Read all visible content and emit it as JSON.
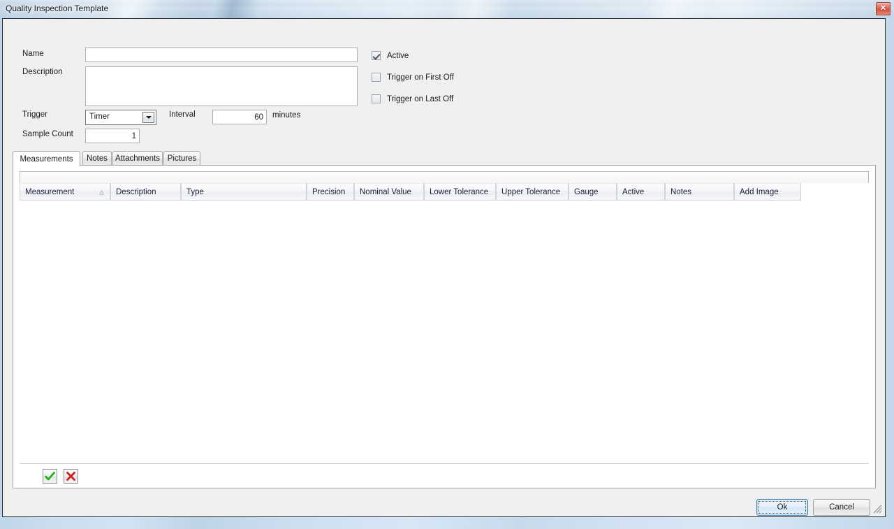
{
  "window": {
    "title": "Quality Inspection Template",
    "close_label": "✕",
    "close_icon": "close-icon",
    "resize_grip_icon": "resize-grip-icon"
  },
  "form": {
    "name": {
      "label": "Name",
      "value": "",
      "placeholder": ""
    },
    "description": {
      "label": "Description",
      "value": "",
      "placeholder": ""
    },
    "trigger": {
      "label": "Trigger",
      "value": "Timer",
      "options": [
        "Timer"
      ],
      "dropdown_icon": "chevron-down-icon"
    },
    "interval": {
      "label": "Interval",
      "value": "60",
      "units": "minutes"
    },
    "sample_count": {
      "label": "Sample Count",
      "value": "1"
    },
    "checkboxes": [
      {
        "label": "Active",
        "checked": true
      },
      {
        "label": "Trigger on First Off",
        "checked": false
      },
      {
        "label": "Trigger on Last Off",
        "checked": false
      }
    ]
  },
  "tabs": [
    {
      "label": "Measurements",
      "selected": true
    },
    {
      "label": "Notes",
      "selected": false
    },
    {
      "label": "Attachments",
      "selected": false
    },
    {
      "label": "Pictures",
      "selected": false
    }
  ],
  "grid": {
    "columns": [
      {
        "label": "Measurement",
        "sort": "ascending"
      },
      {
        "label": "Description",
        "sort": ""
      },
      {
        "label": "Type",
        "sort": ""
      },
      {
        "label": "Precision",
        "sort": ""
      },
      {
        "label": "Nominal Value",
        "sort": ""
      },
      {
        "label": "Lower Tolerance",
        "sort": ""
      },
      {
        "label": "Upper Tolerance",
        "sort": ""
      },
      {
        "label": "Gauge",
        "sort": ""
      },
      {
        "label": "Active",
        "sort": ""
      },
      {
        "label": "Notes",
        "sort": ""
      },
      {
        "label": "Add Image",
        "sort": ""
      }
    ],
    "rows": [],
    "empty": true
  },
  "grid_actions": {
    "accept_icon": "check-icon",
    "accept_label": "Accept",
    "reject_icon": "cross-icon",
    "reject_label": "Cancel Edit",
    "accept_color": "#22b014",
    "reject_color": "#d21f1f"
  },
  "dialog_buttons": {
    "ok": "Ok",
    "cancel": "Cancel"
  }
}
